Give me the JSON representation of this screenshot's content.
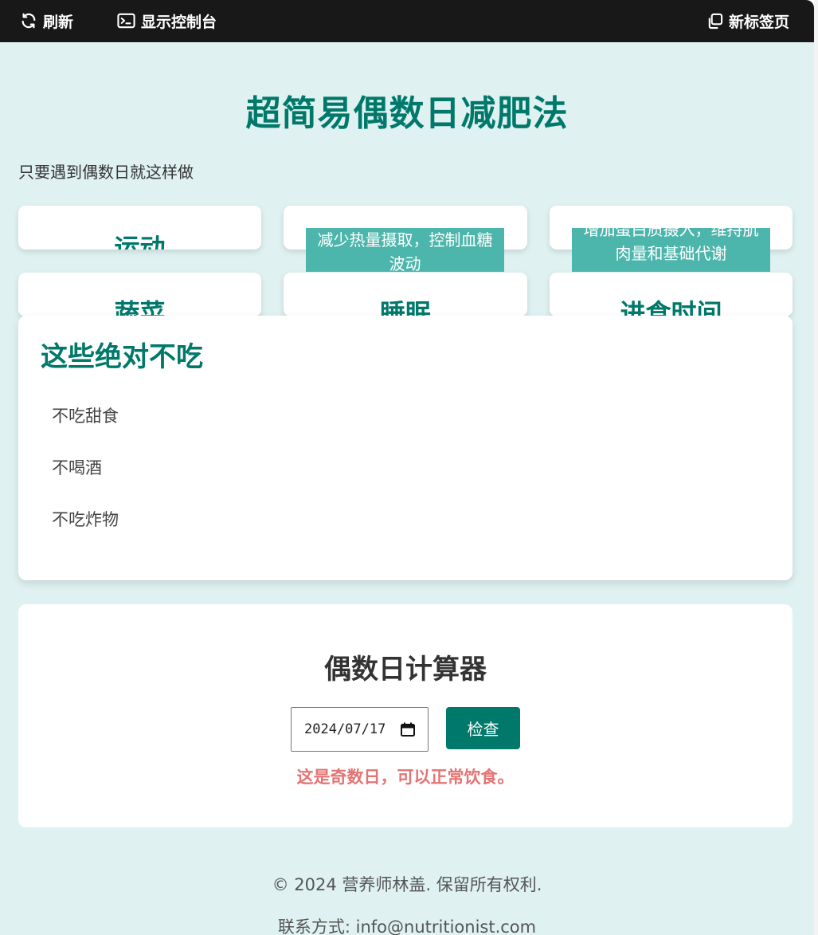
{
  "toolbar": {
    "refresh_label": "刷新",
    "console_label": "显示控制台",
    "new_tab_label": "新标签页"
  },
  "page": {
    "title": "超简易偶数日减肥法",
    "subtitle": "只要遇到偶数日就这样做"
  },
  "cards": [
    {
      "title": "运动"
    },
    {
      "tip": "减少热量摄取，控制血糖波动"
    },
    {
      "tip": "增加蛋白质摄入，维持肌肉量和基础代谢"
    },
    {
      "title": "蔬菜"
    },
    {
      "title": "睡眠"
    },
    {
      "title": "进食时间"
    }
  ],
  "avoid": {
    "heading": "这些绝对不吃",
    "items": [
      "不吃甜食",
      "不喝酒",
      "不吃炸物"
    ]
  },
  "calculator": {
    "heading": "偶数日计算器",
    "date_value": "2024/07/17",
    "check_label": "检查",
    "result": "这是奇数日，可以正常饮食。"
  },
  "footer": {
    "copyright": "© 2024 营养师林盖. 保留所有权利.",
    "contact": "联系方式: info@nutritionist.com"
  },
  "colors": {
    "accent": "#00796b",
    "tip_bg": "#4db6ac",
    "page_bg": "#dff1f1",
    "result": "#e57373"
  }
}
